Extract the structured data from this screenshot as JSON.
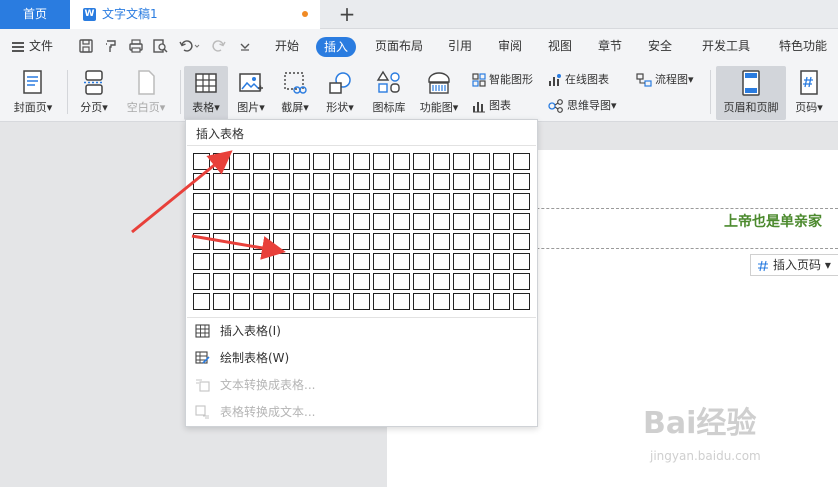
{
  "tabs": {
    "home": "首页",
    "doc_title": "文字文稿1",
    "doc_icon": "W",
    "new_tab": "+"
  },
  "menu": {
    "file": "文件",
    "items": [
      "开始",
      "插入",
      "页面布局",
      "引用",
      "审阅",
      "视图",
      "章节",
      "安全",
      "开发工具",
      "特色功能"
    ],
    "active_index": 1
  },
  "ribbon": {
    "cover": "封面页",
    "pagebreak": "分页",
    "blank_page": "空白页",
    "table": "表格",
    "picture": "图片",
    "screenshot": "截屏",
    "shape": "形状",
    "icon_lib": "图标库",
    "func_chart": "功能图",
    "smart_graphic": "智能图形",
    "chart": "图表",
    "online_chart": "在线图表",
    "mind_map": "思维导图",
    "flowchart": "流程图",
    "header_footer": "页眉和页脚",
    "page_num": "页码"
  },
  "dropdown": {
    "title": "插入表格",
    "grid_cols": 17,
    "grid_rows": 8,
    "items": [
      {
        "label": "插入表格(I)",
        "icon": "table-icon",
        "enabled": true
      },
      {
        "label": "绘制表格(W)",
        "icon": "draw-table-icon",
        "enabled": true
      },
      {
        "label": "文本转换成表格...",
        "icon": "text-to-table-icon",
        "enabled": false
      },
      {
        "label": "表格转换成文本...",
        "icon": "table-to-text-icon",
        "enabled": false
      }
    ]
  },
  "document": {
    "header_text": "上帝也是单亲家",
    "insert_page_num": "插入页码"
  },
  "watermark": {
    "brand": "Bai经验",
    "url": "jingyan.baidu.com"
  },
  "colors": {
    "accent": "#2a7ce0",
    "arrow": "#e8403a",
    "header_text": "#4c8a2e"
  }
}
